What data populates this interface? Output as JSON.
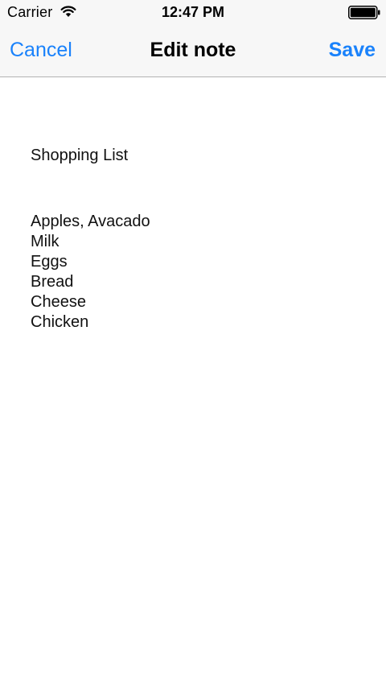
{
  "status_bar": {
    "carrier": "Carrier",
    "time": "12:47 PM",
    "wifi_icon": "wifi-icon",
    "battery_icon": "battery-icon"
  },
  "nav": {
    "cancel_label": "Cancel",
    "title": "Edit note",
    "save_label": "Save"
  },
  "note": {
    "title": "Shopping List",
    "lines": [
      "Apples, Avacado",
      "Milk",
      "Eggs",
      "Bread",
      "Cheese",
      "Chicken"
    ]
  },
  "colors": {
    "accent": "#1a82fb",
    "bar_background": "#f7f7f7",
    "text": "#111111"
  }
}
